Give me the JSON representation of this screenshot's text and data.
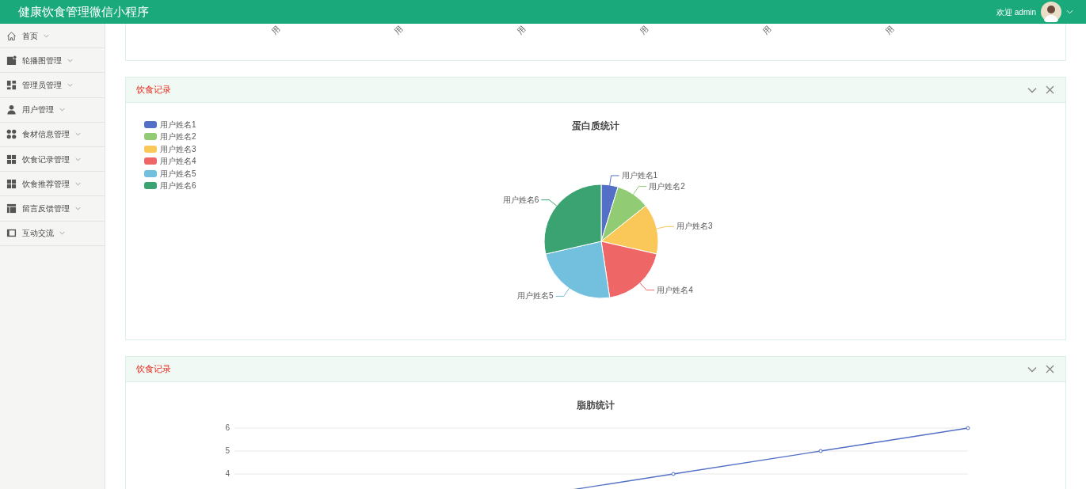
{
  "header": {
    "title": "健康饮食管理微信小程序",
    "welcome": "欢迎 admin"
  },
  "sidebar": {
    "items": [
      {
        "label": "首页",
        "kind": "home"
      },
      {
        "label": "轮播图管理",
        "kind": "image"
      },
      {
        "label": "管理员管理",
        "kind": "blocks"
      },
      {
        "label": "用户管理",
        "kind": "user"
      },
      {
        "label": "食材信息管理",
        "kind": "dots"
      },
      {
        "label": "饮食记录管理",
        "kind": "grid"
      },
      {
        "label": "饮食推荐管理",
        "kind": "grid"
      },
      {
        "label": "留言反馈管理",
        "kind": "table"
      },
      {
        "label": "互动交流",
        "kind": "panel"
      }
    ]
  },
  "top_card": {
    "axis_labels": [
      "用",
      "用",
      "用",
      "用",
      "用",
      "用"
    ]
  },
  "cards": [
    {
      "title": "饮食记录",
      "legend": [
        {
          "label": "用户姓名1",
          "color": "#5470c6"
        },
        {
          "label": "用户姓名2",
          "color": "#91cc75"
        },
        {
          "label": "用户姓名3",
          "color": "#fac858"
        },
        {
          "label": "用户姓名4",
          "color": "#ee6666"
        },
        {
          "label": "用户姓名5",
          "color": "#73c0de"
        },
        {
          "label": "用户姓名6",
          "color": "#3ba272"
        }
      ],
      "chart_data": {
        "type": "pie",
        "title": "蛋白质统计",
        "categories": [
          "用户姓名1",
          "用户姓名2",
          "用户姓名3",
          "用户姓名4",
          "用户姓名5",
          "用户姓名6"
        ],
        "values": [
          1,
          2,
          3,
          4,
          5,
          6
        ]
      }
    },
    {
      "title": "饮食记录",
      "kind": "line",
      "chart_title": "脂肪统计",
      "y_axis_labels": [
        "6",
        "5",
        "4"
      ]
    }
  ]
}
